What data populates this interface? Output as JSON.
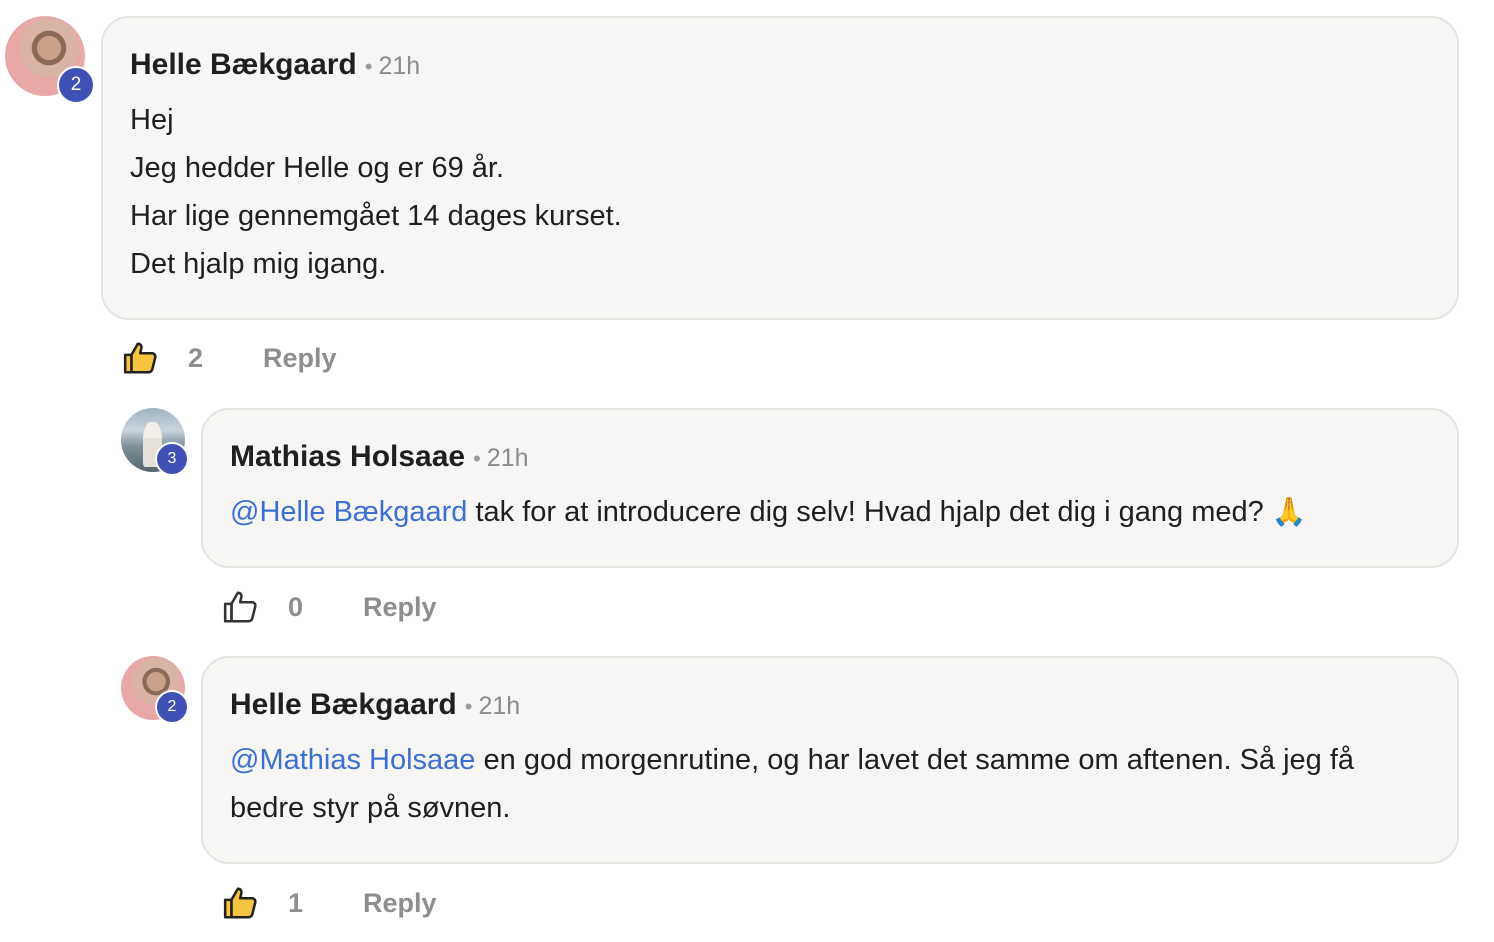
{
  "comments": [
    {
      "author": "Helle Bækgaard",
      "level": "2",
      "time": "21h",
      "lines": [
        "Hej",
        "Jeg hedder Helle og er 69 år.",
        "Har lige gennemgået 14 dages kurset.",
        "Det hjalp mig igang."
      ],
      "likes": "2",
      "liked": true,
      "reply_label": "Reply"
    },
    {
      "author": "Mathias Holsaae",
      "level": "3",
      "time": "21h",
      "mention": "@Helle Bækgaard",
      "text": " tak for at introducere dig selv! Hvad hjalp det dig i gang med? ",
      "emoji": "🙏",
      "likes": "0",
      "liked": false,
      "reply_label": "Reply"
    },
    {
      "author": "Helle Bækgaard",
      "level": "2",
      "time": "21h",
      "mention": "@Mathias Holsaae",
      "text": " en god morgenrutine, og har lavet det samme om aftenen. Så jeg få bedre styr på søvnen.",
      "likes": "1",
      "liked": true,
      "reply_label": "Reply"
    }
  ],
  "colors": {
    "mention": "#3b6fd4",
    "level_badge": "#3f51b5",
    "bubble_bg": "#f7f6f4",
    "liked_fill": "#f5c542"
  }
}
